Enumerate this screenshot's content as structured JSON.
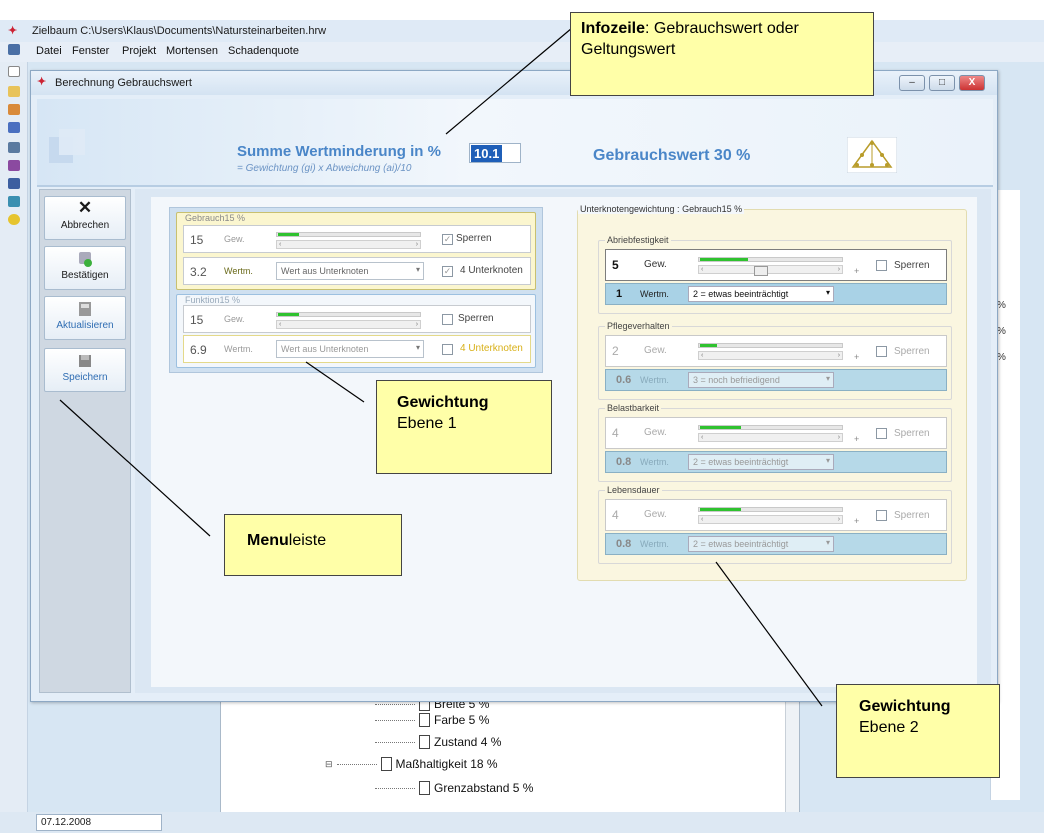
{
  "app": {
    "title": "Zielbaum C:\\Users\\Klaus\\Documents\\Natursteinarbeiten.hrw",
    "menu": [
      "Datei",
      "Fenster",
      "Projekt",
      "Mortensen",
      "Schadenquote"
    ],
    "status_date": "07.12.2008"
  },
  "dialog": {
    "title": "Berechnung Gebrauchswert",
    "close_label": "X"
  },
  "header": {
    "sum_title": "Summe Wertminderung in %",
    "sum_subtitle": "= Gewichtung (gi) x Abweichung (ai)/10",
    "sum_value": "10.1",
    "value_label": "Gebrauchswert  30 %"
  },
  "side_menu": {
    "abbrechen": "Abbrechen",
    "bestaetigen": "Bestätigen",
    "aktualisieren": "Aktualisieren",
    "speichern": "Speichern"
  },
  "level1": {
    "gebrauch": {
      "legend": "Gebrauch15 %",
      "gew_value": "15",
      "gew_label": "Gew.",
      "wertm_value": "3.2",
      "wertm_label": "Wertm.",
      "dropdown": "Wert aus Unterknoten",
      "lock_label": "Sperren",
      "sub_label": "4 Unterknoten",
      "slider_fraction": 0.15
    },
    "funktion": {
      "legend": "Funktion15 %",
      "gew_value": "15",
      "gew_label": "Gew.",
      "wertm_value": "6.9",
      "wertm_label": "Wertm.",
      "dropdown": "Wert aus Unterknoten",
      "lock_label": "Sperren",
      "sub_label": "4 Unterknoten",
      "slider_fraction": 0.15
    }
  },
  "level2": {
    "title": "Unterknotengewichtung : Gebrauch15 %",
    "items": [
      {
        "legend": "Abriebfestigkeit",
        "gew": "5",
        "gew_label": "Gew.",
        "lock": "Sperren",
        "wert": "1",
        "wert_label": "Wertm.",
        "dropdown": "2 = etwas beeinträchtigt",
        "slider_fraction": 0.35
      },
      {
        "legend": "Pflegeverhalten",
        "gew": "2",
        "gew_label": "Gew.",
        "lock": "Sperren",
        "wert": "0.6",
        "wert_label": "Wertm.",
        "dropdown": "3 = noch befriedigend",
        "slider_fraction": 0.12
      },
      {
        "legend": "Belastbarkeit",
        "gew": "4",
        "gew_label": "Gew.",
        "lock": "Sperren",
        "wert": "0.8",
        "wert_label": "Wertm.",
        "dropdown": "2 = etwas beeinträchtigt",
        "slider_fraction": 0.3
      },
      {
        "legend": "Lebensdauer",
        "gew": "4",
        "gew_label": "Gew.",
        "lock": "Sperren",
        "wert": "0.8",
        "wert_label": "Wertm.",
        "dropdown": "2 = etwas beeinträchtigt",
        "slider_fraction": 0.3
      }
    ]
  },
  "tree": {
    "items": [
      "Farbe  5 %",
      "Zustand  4 %",
      "Maßhaltigkeit 18 %",
      "Grenzabstand  5 %"
    ],
    "partial": "Breite  5 %"
  },
  "annotations": {
    "infozeile_bold": "Infozeile",
    "infozeile_rest": ": Gebrauchswert oder Geltungswert",
    "gew1_bold": "Gewichtung",
    "gew1_rest": "Ebene 1",
    "menu_bold": "Menu",
    "menu_rest": "leiste",
    "gew2_bold": "Gewichtung",
    "gew2_rest": "Ebene 2"
  },
  "colors": {
    "accent_blue": "#4a86c8",
    "slider_green": "#2fc22f",
    "note_yellow": "#ffffa8"
  }
}
